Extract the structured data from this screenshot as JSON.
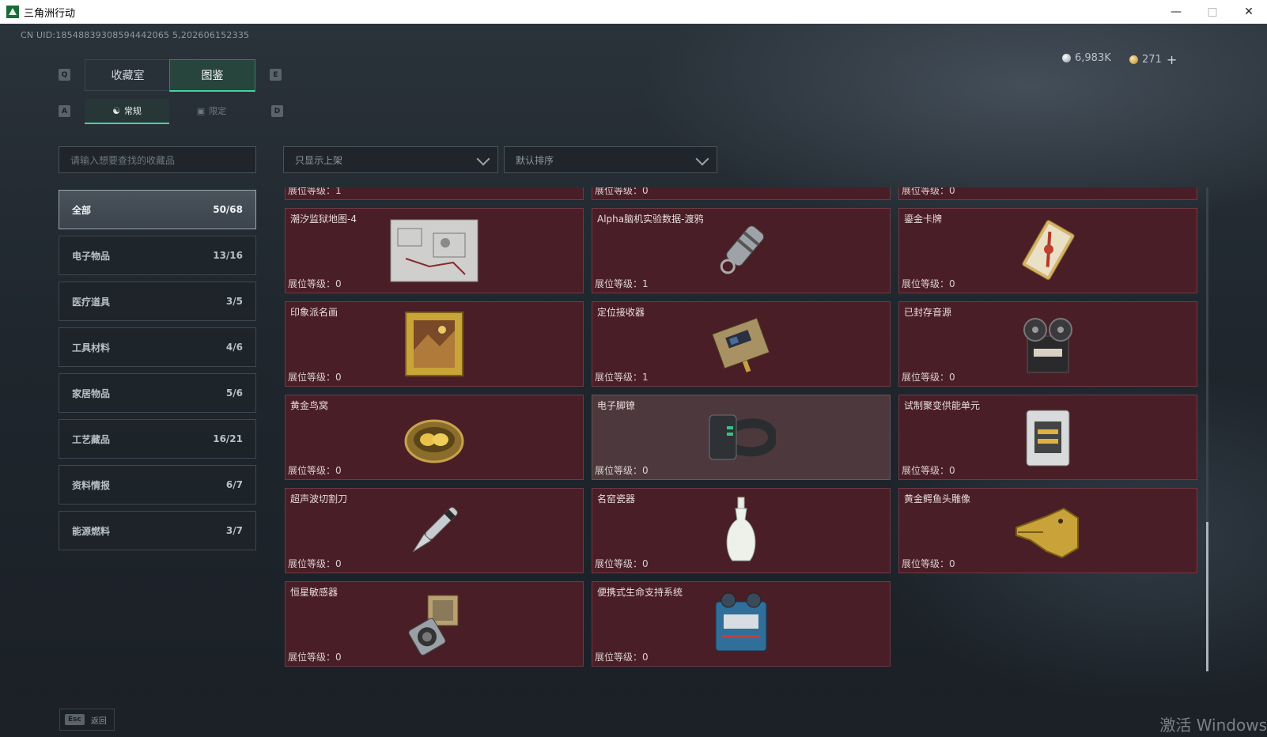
{
  "window": {
    "title": "三角洲行动"
  },
  "uid": "CN UID:18548839308594442065 5,202606152335",
  "currency": {
    "silver": "6,983K",
    "gold": "271"
  },
  "tabs": {
    "main": [
      "收藏室",
      "图鉴"
    ],
    "sub": [
      "常规",
      "限定"
    ]
  },
  "keyhints": {
    "q": "Q",
    "e": "E",
    "a": "A",
    "d": "D"
  },
  "search": {
    "placeholder": "请输入想要查找的收藏品"
  },
  "filters": {
    "shelf": "只显示上架",
    "sort": "默认排序"
  },
  "categories": [
    {
      "name": "全部",
      "count": "50/68"
    },
    {
      "name": "电子物品",
      "count": "13/16"
    },
    {
      "name": "医疗道具",
      "count": "3/5"
    },
    {
      "name": "工具材料",
      "count": "4/6"
    },
    {
      "name": "家居物品",
      "count": "5/6"
    },
    {
      "name": "工艺藏品",
      "count": "16/21"
    },
    {
      "name": "资料情报",
      "count": "6/7"
    },
    {
      "name": "能源燃料",
      "count": "3/7"
    }
  ],
  "level_prefix": "展位等级：",
  "partial_row": [
    "展位等级：1",
    "展位等级：0",
    "展位等级：0"
  ],
  "items": [
    {
      "name": "潮汐监狱地图-4",
      "level": "展位等级：0",
      "icon": "map-icon"
    },
    {
      "name": "Alpha脑机实验数据-渡鸦",
      "level": "展位等级：1",
      "icon": "data-canister-icon"
    },
    {
      "name": "鎏金卡牌",
      "level": "展位等级：0",
      "icon": "gilded-card-icon"
    },
    {
      "name": "印象派名画",
      "level": "展位等级：0",
      "icon": "painting-icon"
    },
    {
      "name": "定位接收器",
      "level": "展位等级：1",
      "icon": "receiver-icon"
    },
    {
      "name": "已封存音源",
      "level": "展位等级：0",
      "icon": "reel-recorder-icon"
    },
    {
      "name": "黄金鸟窝",
      "level": "展位等级：0",
      "icon": "golden-nest-icon"
    },
    {
      "name": "电子脚镣",
      "level": "展位等级：0",
      "icon": "ankle-monitor-icon"
    },
    {
      "name": "试制聚变供能单元",
      "level": "展位等级：0",
      "icon": "fusion-unit-icon"
    },
    {
      "name": "超声波切割刀",
      "level": "展位等级：0",
      "icon": "ultrasonic-knife-icon"
    },
    {
      "name": "名窑瓷器",
      "level": "展位等级：0",
      "icon": "porcelain-vase-icon"
    },
    {
      "name": "黄金鳄鱼头雕像",
      "level": "展位等级：0",
      "icon": "gold-crocodile-icon"
    },
    {
      "name": "恒星敏感器",
      "level": "展位等级：0",
      "icon": "star-sensor-icon"
    },
    {
      "name": "便携式生命支持系统",
      "level": "展位等级：0",
      "icon": "life-support-icon"
    }
  ],
  "footer": {
    "esc_key": "Esc",
    "back_label": "返回",
    "watermark": "激活 Windows"
  },
  "colors": {
    "accent": "#42d3a0",
    "card_bg": "#4a1e26",
    "card_border": "#6e3a44"
  }
}
